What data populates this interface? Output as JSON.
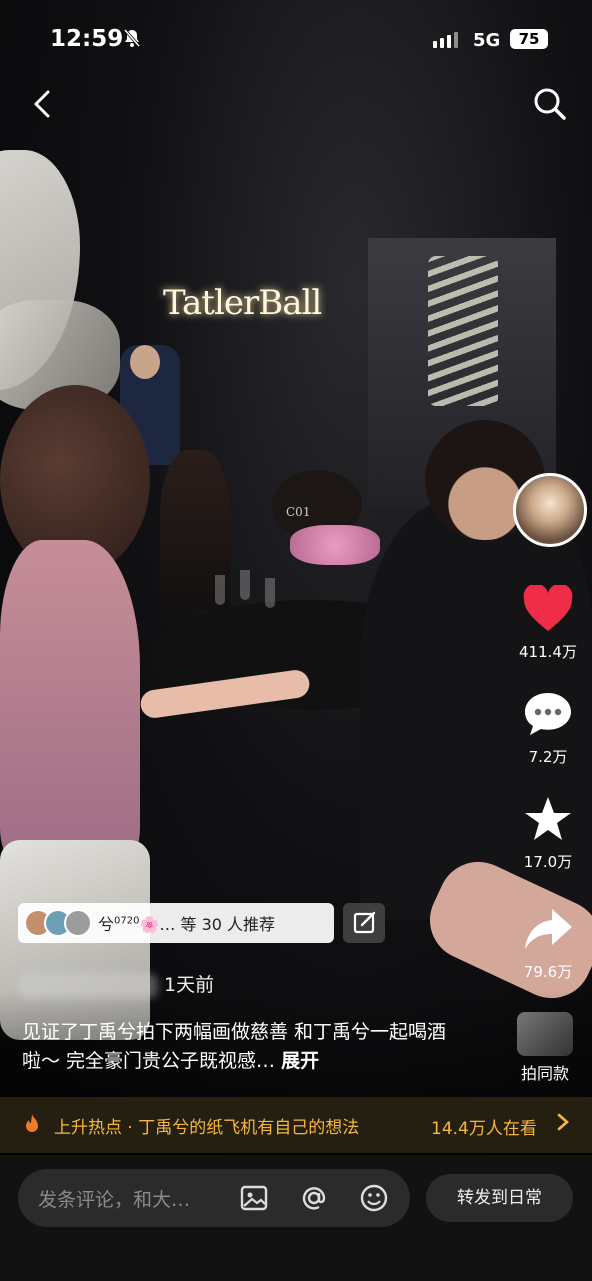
{
  "status_bar": {
    "time": "12:59",
    "network": "5G",
    "battery": "75"
  },
  "video": {
    "logo_text": "TatlerBall",
    "table_card": "C01"
  },
  "side_actions": {
    "likes": "411.4万",
    "comments": "7.2万",
    "favorites": "17.0万",
    "shares": "79.6万"
  },
  "recommend": {
    "text": "兮",
    "superscript": "0720",
    "suffix": "🌸… 等 30 人推荐"
  },
  "author": {
    "time": "1天前"
  },
  "description": {
    "text": "见证了丁禹兮拍下两幅画做慈善 和丁禹兮一起喝酒啦～ 完全豪门贵公子既视感…",
    "expand_label": "展开"
  },
  "same_style": {
    "label": "拍同款"
  },
  "hot_topic": {
    "text": "上升热点 · 丁禹兮的纸飞机有自己的想法",
    "watchers": "14.4万人在看"
  },
  "comment_bar": {
    "placeholder": "发条评论，和大…",
    "share_label": "转发到日常"
  },
  "colors": {
    "like": "#f02d46",
    "hot_accent": "#f6b73c"
  }
}
